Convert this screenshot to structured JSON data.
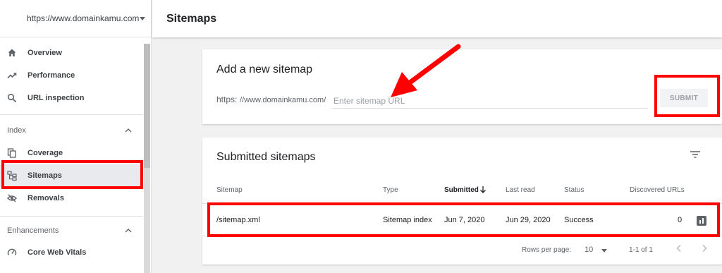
{
  "property": {
    "url": "https://www.domainkamu.com"
  },
  "sidebar": {
    "items": [
      {
        "label": "Overview",
        "icon": "home-icon"
      },
      {
        "label": "Performance",
        "icon": "trending-up-icon"
      },
      {
        "label": "URL inspection",
        "icon": "search-icon"
      }
    ],
    "index_section": {
      "label": "Index",
      "items": [
        {
          "label": "Coverage",
          "icon": "file-copy-icon"
        },
        {
          "label": "Sitemaps",
          "icon": "sitemap-icon"
        },
        {
          "label": "Removals",
          "icon": "eye-off-icon"
        }
      ]
    },
    "enhancements_section": {
      "label": "Enhancements",
      "items": [
        {
          "label": "Core Web Vitals",
          "icon": "speedometer-icon"
        }
      ]
    }
  },
  "header": {
    "title": "Sitemaps"
  },
  "add_sitemap": {
    "title": "Add a new sitemap",
    "prefix_scheme": "https:",
    "prefix_domain": "//www.domainkamu.com/",
    "placeholder": "Enter sitemap URL",
    "submit_label": "SUBMIT"
  },
  "submitted": {
    "title": "Submitted sitemaps",
    "columns": [
      "Sitemap",
      "Type",
      "Submitted",
      "Last read",
      "Status",
      "Discovered URLs"
    ],
    "rows": [
      {
        "sitemap": "/sitemap.xml",
        "type": "Sitemap index",
        "submitted": "Jun 7, 2020",
        "last_read": "Jun 29, 2020",
        "status": "Success",
        "discovered": "0"
      }
    ],
    "footer": {
      "rows_per_page_label": "Rows per page:",
      "rows_per_page": "10",
      "range": "1-1 of 1"
    }
  },
  "colors": {
    "annotation": "#ff0000",
    "active_nav": "#e8eaed"
  }
}
